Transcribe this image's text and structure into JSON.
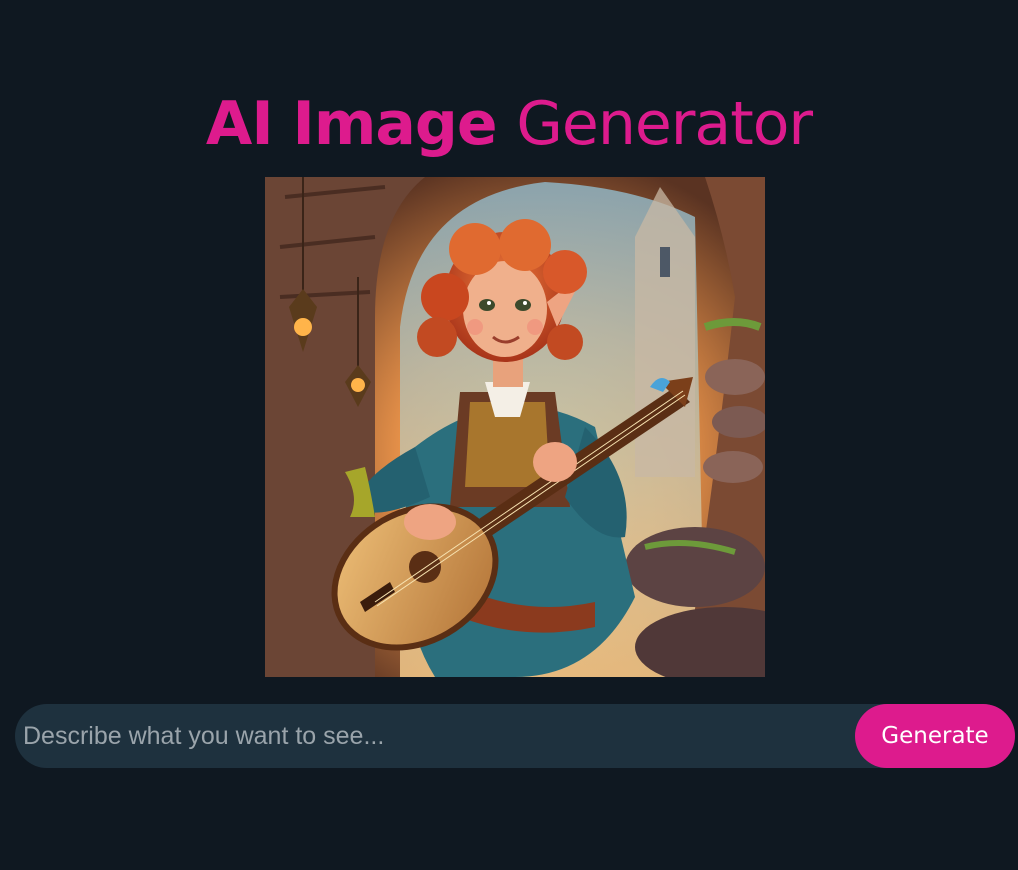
{
  "header": {
    "title_part1": "AI Image",
    "title_part2": "Generator"
  },
  "image": {
    "alt": "Red-haired elf girl playing a lute"
  },
  "prompt": {
    "placeholder": "Describe what you want to see...",
    "value": "",
    "generate_label": "Generate"
  },
  "colors": {
    "background": "#0f1821",
    "accent": "#dd1b8d",
    "input_background": "#1e313e"
  }
}
